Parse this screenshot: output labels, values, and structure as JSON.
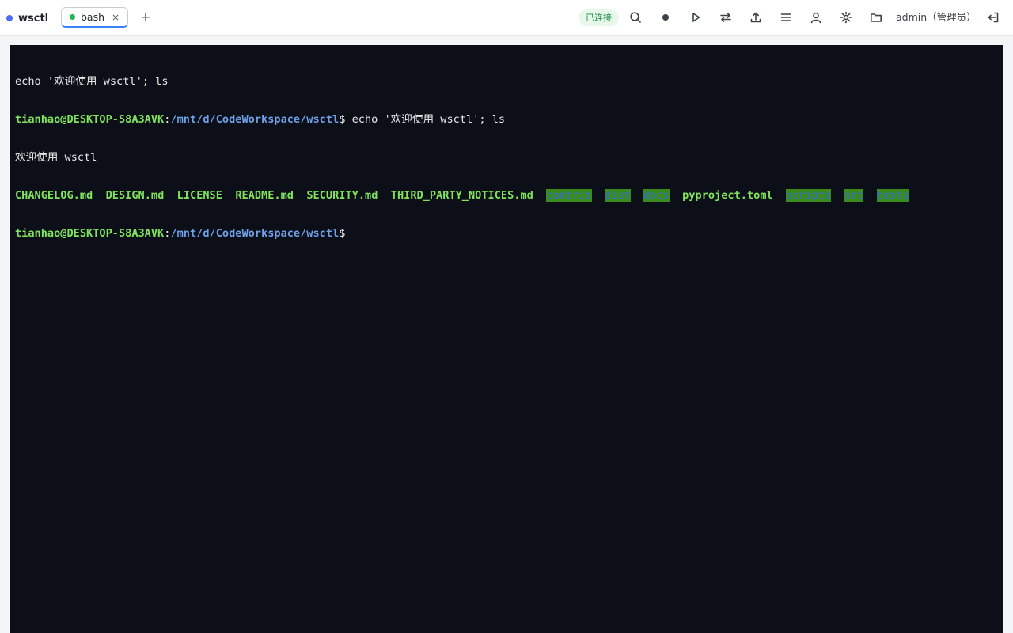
{
  "app": {
    "title": "wsctl"
  },
  "tabs": [
    {
      "label": "bash",
      "close": "×"
    }
  ],
  "new_tab": "+",
  "header": {
    "status": "已连接",
    "icons": [
      "search-icon",
      "record-icon",
      "play-icon",
      "swap-icon",
      "upload-icon",
      "menu-icon",
      "user-icon",
      "settings-icon",
      "folder-icon",
      "logout-icon"
    ],
    "user_label": "admin（管理员）"
  },
  "colors": {
    "accent": "#3b82f6",
    "connected": "#22b357",
    "terminal_bg": "#0c0f17",
    "prompt_user": "#7fe35b",
    "prompt_path": "#6fa0e8",
    "dir_bg": "#3a8a1c"
  },
  "terminal": {
    "line1": "echo '欢迎使用 wsctl'; ls",
    "prompt_user": "tianhao@DESKTOP-S8A3AVK",
    "prompt_colon": ":",
    "prompt_path": "/mnt/d/CodeWorkspace/wsctl",
    "prompt_dollar": "$",
    "command": " echo '欢迎使用 wsctl'; ls",
    "output": "欢迎使用 wsctl",
    "ls": [
      {
        "name": "CHANGELOG.md",
        "type": "file"
      },
      {
        "name": "DESIGN.md",
        "type": "file"
      },
      {
        "name": "LICENSE",
        "type": "file"
      },
      {
        "name": "README.md",
        "type": "file"
      },
      {
        "name": "SECURITY.md",
        "type": "file"
      },
      {
        "name": "THIRD_PARTY_NOTICES.md",
        "type": "file"
      },
      {
        "name": "contrib",
        "type": "dir"
      },
      {
        "name": "dist",
        "type": "dir"
      },
      {
        "name": "docs",
        "type": "dir"
      },
      {
        "name": "pyproject.toml",
        "type": "file"
      },
      {
        "name": "scripts",
        "type": "dir"
      },
      {
        "name": "src",
        "type": "dir"
      },
      {
        "name": "tests",
        "type": "dir"
      }
    ]
  }
}
